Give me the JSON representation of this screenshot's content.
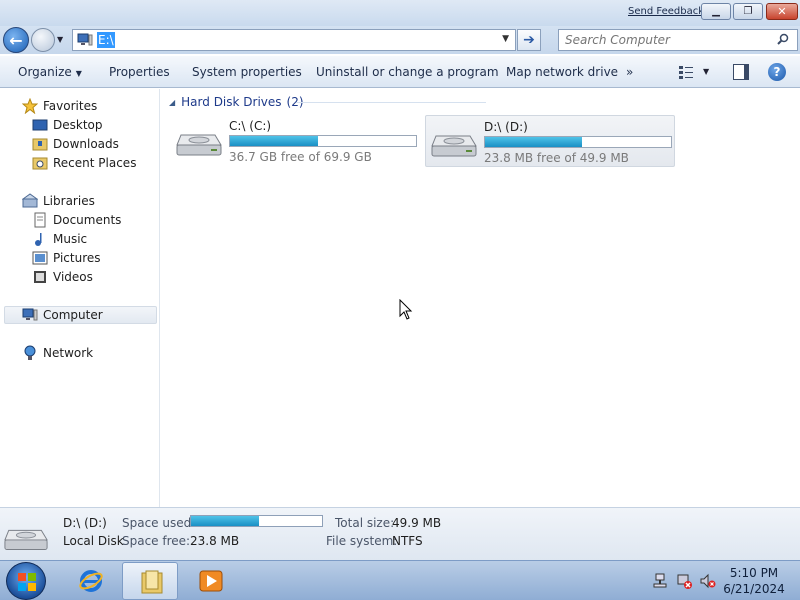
{
  "titlebar": {
    "send_feedback": "Send Feedback"
  },
  "address": {
    "path": "E:\\",
    "search_placeholder": "Search Computer"
  },
  "commands": [
    {
      "label": "Organize",
      "has_dropdown": true
    },
    {
      "label": "Properties"
    },
    {
      "label": "System properties"
    },
    {
      "label": "Uninstall or change a program"
    },
    {
      "label": "Map network drive"
    },
    {
      "label": "»"
    }
  ],
  "nav": {
    "favorites": "Favorites",
    "desktop": "Desktop",
    "downloads": "Downloads",
    "recent_places": "Recent Places",
    "libraries": "Libraries",
    "documents": "Documents",
    "music": "Music",
    "pictures": "Pictures",
    "videos": "Videos",
    "computer": "Computer",
    "network": "Network"
  },
  "content": {
    "group_header": "Hard Disk Drives",
    "group_count": "(2)",
    "drives": [
      {
        "name": "C:\\ (C:)",
        "free_text": "36.7 GB free of 69.9 GB",
        "used_fraction": 0.475
      },
      {
        "name": "D:\\ (D:)",
        "free_text": "23.8 MB free of 49.9 MB",
        "used_fraction": 0.52
      }
    ]
  },
  "details": {
    "name": "D:\\ (D:)",
    "type": "Local Disk",
    "space_used_label": "Space used:",
    "space_used_fraction": 0.52,
    "space_free_label": "Space free:",
    "space_free_value": "23.8 MB",
    "total_size_label": "Total size:",
    "total_size_value": "49.9 MB",
    "file_system_label": "File system:",
    "file_system_value": "NTFS"
  },
  "taskbar": {
    "time": "5:10 PM",
    "date": "6/21/2024"
  },
  "colors": {
    "accent": "#3399ff",
    "progress": "#1a8fc4",
    "link": "#1e3a8a"
  }
}
